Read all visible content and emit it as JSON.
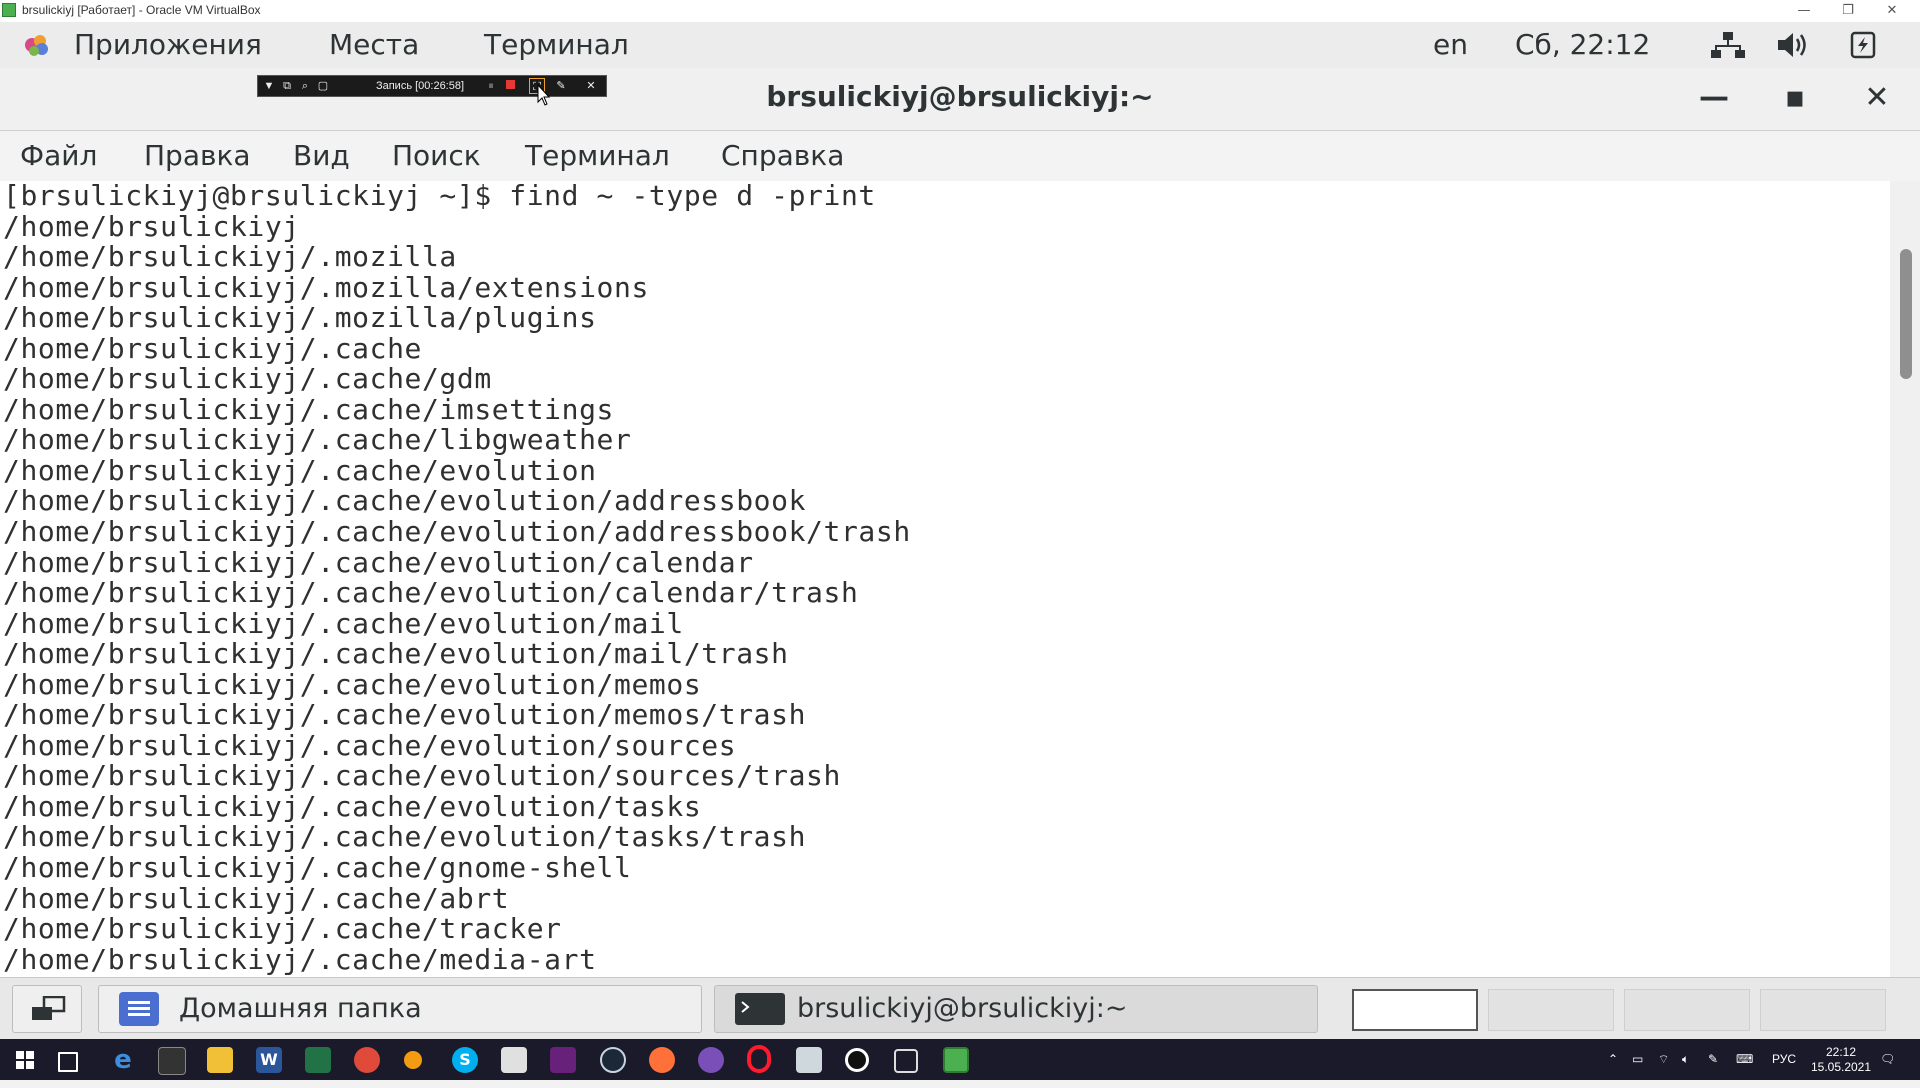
{
  "vbox": {
    "title": "brsulickiyj [Работает] - Oracle VM VirtualBox",
    "minimize": "—",
    "restore": "❐",
    "close": "✕"
  },
  "gnome_bar": {
    "applications": "Приложения",
    "places": "Места",
    "terminal": "Терминал",
    "lang": "en",
    "clock": "Сб, 22:12"
  },
  "recorder": {
    "label": "Запись [00:26:58]"
  },
  "terminal": {
    "title": "brsulickiyj@brsulickiyj:~",
    "minimize": "—",
    "maximize": "▪",
    "close": "✕",
    "menu": {
      "file": "Файл",
      "edit": "Правка",
      "view": "Вид",
      "search": "Поиск",
      "terminal": "Терминал",
      "help": "Справка"
    },
    "lines": [
      "[brsulickiyj@brsulickiyj ~]$ find ~ -type d -print",
      "/home/brsulickiyj",
      "/home/brsulickiyj/.mozilla",
      "/home/brsulickiyj/.mozilla/extensions",
      "/home/brsulickiyj/.mozilla/plugins",
      "/home/brsulickiyj/.cache",
      "/home/brsulickiyj/.cache/gdm",
      "/home/brsulickiyj/.cache/imsettings",
      "/home/brsulickiyj/.cache/libgweather",
      "/home/brsulickiyj/.cache/evolution",
      "/home/brsulickiyj/.cache/evolution/addressbook",
      "/home/brsulickiyj/.cache/evolution/addressbook/trash",
      "/home/brsulickiyj/.cache/evolution/calendar",
      "/home/brsulickiyj/.cache/evolution/calendar/trash",
      "/home/brsulickiyj/.cache/evolution/mail",
      "/home/brsulickiyj/.cache/evolution/mail/trash",
      "/home/brsulickiyj/.cache/evolution/memos",
      "/home/brsulickiyj/.cache/evolution/memos/trash",
      "/home/brsulickiyj/.cache/evolution/sources",
      "/home/brsulickiyj/.cache/evolution/sources/trash",
      "/home/brsulickiyj/.cache/evolution/tasks",
      "/home/brsulickiyj/.cache/evolution/tasks/trash",
      "/home/brsulickiyj/.cache/gnome-shell",
      "/home/brsulickiyj/.cache/abrt",
      "/home/brsulickiyj/.cache/tracker",
      "/home/brsulickiyj/.cache/media-art"
    ]
  },
  "taskbar": {
    "home_folder": "Домашняя папка",
    "terminal_window": "brsulickiyj@brsulickiyj:~"
  },
  "windows_tray": {
    "lang": "РУС",
    "time": "22:12",
    "date": "15.05.2021"
  },
  "colors": {
    "record": "#e53935",
    "windows_taskbar": "#1a1a2a",
    "accent_blue": "#4a6fd0"
  }
}
